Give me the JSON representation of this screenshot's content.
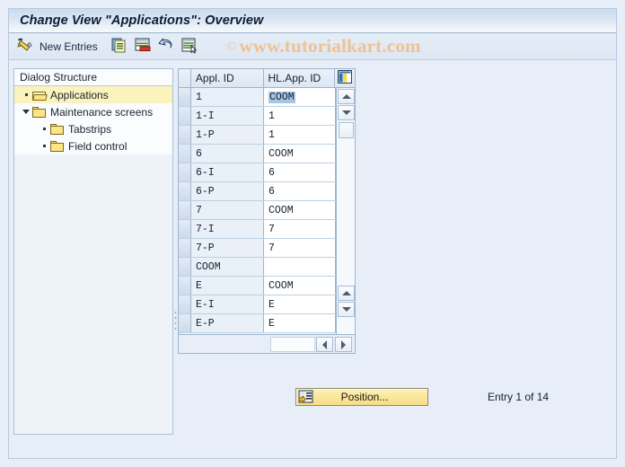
{
  "window": {
    "title": "Change View \"Applications\": Overview"
  },
  "watermark": {
    "copyright_symbol": "©",
    "text": "www.tutorialkart.com"
  },
  "toolbar": {
    "display_change_icon": "pencil-edit-icon",
    "new_entries_label": "New Entries",
    "copy_icon": "copy-icon",
    "delete_icon": "delete-row-icon",
    "undo_icon": "undo-arrow-icon",
    "select_all_icon": "select-details-icon"
  },
  "tree": {
    "header": "Dialog Structure",
    "items": [
      {
        "label": "Applications",
        "level": 1,
        "twisty": "dot",
        "folder": "open",
        "selected": true
      },
      {
        "label": "Maintenance screens",
        "level": 1,
        "twisty": "triangle-down",
        "folder": "closed",
        "selected": false
      },
      {
        "label": "Tabstrips",
        "level": 2,
        "twisty": "dot",
        "folder": "closed",
        "selected": false
      },
      {
        "label": "Field control",
        "level": 2,
        "twisty": "dot",
        "folder": "closed",
        "selected": false
      }
    ]
  },
  "grid": {
    "config_icon": "column-config-icon",
    "columns": [
      "Appl. ID",
      "HL.App. ID"
    ],
    "rows": [
      {
        "appl_id": "1",
        "hl_app_id": "COOM",
        "highlight": true
      },
      {
        "appl_id": "1-I",
        "hl_app_id": "1",
        "highlight": false
      },
      {
        "appl_id": "1-P",
        "hl_app_id": "1",
        "highlight": false
      },
      {
        "appl_id": "6",
        "hl_app_id": "COOM",
        "highlight": false
      },
      {
        "appl_id": "6-I",
        "hl_app_id": "6",
        "highlight": false
      },
      {
        "appl_id": "6-P",
        "hl_app_id": "6",
        "highlight": false
      },
      {
        "appl_id": "7",
        "hl_app_id": "COOM",
        "highlight": false
      },
      {
        "appl_id": "7-I",
        "hl_app_id": "7",
        "highlight": false
      },
      {
        "appl_id": "7-P",
        "hl_app_id": "7",
        "highlight": false
      },
      {
        "appl_id": "COOM",
        "hl_app_id": "",
        "highlight": false
      },
      {
        "appl_id": "E",
        "hl_app_id": "COOM",
        "highlight": false
      },
      {
        "appl_id": "E-I",
        "hl_app_id": "E",
        "highlight": false
      },
      {
        "appl_id": "E-P",
        "hl_app_id": "E",
        "highlight": false
      }
    ]
  },
  "footer": {
    "position_button_label": "Position...",
    "position_button_icon": "position-jump-icon",
    "entry_status": "Entry 1 of 14"
  },
  "colors": {
    "page_background": "#e8eef7",
    "panel_border": "#b4c8de",
    "tree_selection": "#fbf3bd",
    "cell_selection": "#a8c6e2",
    "button_yellow": "#fbe79a",
    "watermark": "#f0c191"
  }
}
